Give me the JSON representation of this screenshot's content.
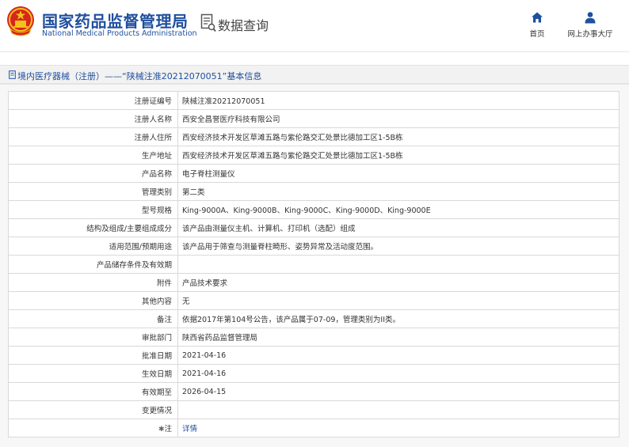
{
  "header": {
    "brand_cn": "国家药品监督管理局",
    "brand_en": "National Medical Products Administration",
    "query_title": "数据查询",
    "nav": [
      {
        "label": "首页",
        "icon": "home-icon"
      },
      {
        "label": "网上办事大厅",
        "icon": "person-icon"
      }
    ]
  },
  "breadcrumb": {
    "text": "境内医疗器械（注册）——“陕械注准20212070051”基本信息",
    "icon": "document-icon"
  },
  "rows": [
    {
      "label": "注册证编号",
      "value": "陕械注准20212070051"
    },
    {
      "label": "注册人名称",
      "value": "西安全昌誉医疗科技有限公司"
    },
    {
      "label": "注册人住所",
      "value": "西安经济技术开发区草滩五路与紫伦路交汇处景比德加工区1-5B栋"
    },
    {
      "label": "生产地址",
      "value": "西安经济技术开发区草滩五路与紫伦路交汇处景比德加工区1-5B栋"
    },
    {
      "label": "产品名称",
      "value": "电子脊柱测量仪"
    },
    {
      "label": "管理类别",
      "value": "第二类"
    },
    {
      "label": "型号规格",
      "value": "King-9000A、King-9000B、King-9000C、King-9000D、King-9000E"
    },
    {
      "label": "结构及组成/主要组成成分",
      "value": "该产品由测量仪主机、计算机、打印机（选配）组成"
    },
    {
      "label": "适用范围/预期用途",
      "value": "该产品用于筛查与测量脊柱畸形、姿势异常及活动度范围。"
    },
    {
      "label": "产品储存条件及有效期",
      "value": ""
    },
    {
      "label": "附件",
      "value": "产品技术要求"
    },
    {
      "label": "其他内容",
      "value": "无"
    },
    {
      "label": "备注",
      "value": "依据2017年第104号公告，该产品属于07-09，管理类别为II类。"
    },
    {
      "label": "审批部门",
      "value": "陕西省药品监督管理局"
    },
    {
      "label": "批准日期",
      "value": "2021-04-16"
    },
    {
      "label": "生效日期",
      "value": "2021-04-16"
    },
    {
      "label": "有效期至",
      "value": "2026-04-15"
    },
    {
      "label": "变更情况",
      "value": ""
    },
    {
      "label": "注",
      "value": "详情",
      "link": true,
      "label_icon": "asterisk-icon"
    }
  ],
  "colors": {
    "brand": "#1f4f9e",
    "emblem_red": "#d7261c",
    "emblem_gold": "#f4c21a",
    "breadcrumb_bg": "#f2f2f2",
    "panel_bg": "#f7f7f7",
    "border": "#d9d9d9"
  }
}
